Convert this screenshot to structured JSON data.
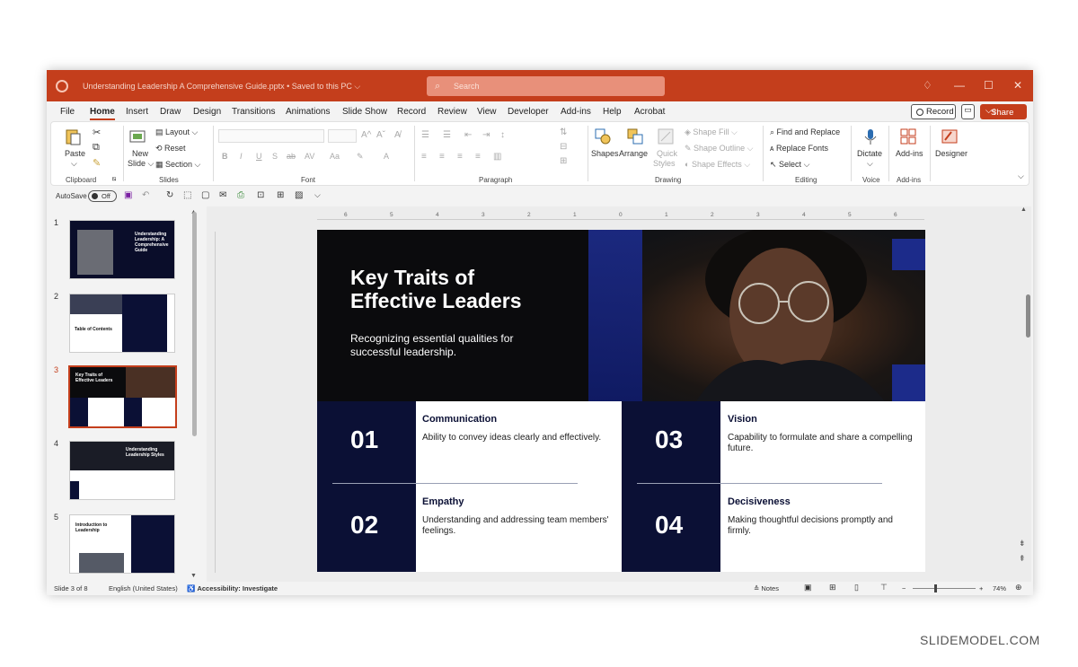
{
  "window": {
    "doc_title": "Understanding Leadership A Comprehensive Guide.pptx  •  Saved to this PC ⌵",
    "search_placeholder": "Search"
  },
  "menu": {
    "tabs": [
      "File",
      "Home",
      "Insert",
      "Draw",
      "Design",
      "Transitions",
      "Animations",
      "Slide Show",
      "Record",
      "Review",
      "View",
      "Developer",
      "Add-ins",
      "Help",
      "Acrobat"
    ],
    "active": "Home",
    "record_label": "Record",
    "share_label": "Share"
  },
  "ribbon": {
    "clipboard": {
      "paste": "Paste",
      "label": "Clipboard"
    },
    "slides": {
      "new_slide": "New",
      "new_slide2": "Slide",
      "layout": "Layout",
      "reset": "Reset",
      "section": "Section",
      "label": "Slides"
    },
    "font": {
      "label": "Font"
    },
    "paragraph": {
      "label": "Paragraph"
    },
    "drawing": {
      "shapes": "Shapes",
      "arrange": "Arrange",
      "quick": "Quick",
      "styles": "Styles",
      "shape_fill": "Shape Fill",
      "shape_outline": "Shape Outline",
      "shape_effects": "Shape Effects",
      "label": "Drawing"
    },
    "editing": {
      "find": "Find and Replace",
      "replace_fonts": "Replace Fonts",
      "select": "Select",
      "label": "Editing"
    },
    "voice": {
      "dictate": "Dictate",
      "label": "Voice"
    },
    "addins": {
      "addins": "Add-ins",
      "label": "Add-ins"
    },
    "designer": {
      "label": "Designer"
    }
  },
  "qat": {
    "autosave": "AutoSave",
    "toggle": "Off"
  },
  "thumbnails": [
    {
      "num": "1",
      "title": "Understanding Leadership: A Comprehensive Guide"
    },
    {
      "num": "2",
      "title": "Table of Contents"
    },
    {
      "num": "3",
      "title": "Key Traits of Effective Leaders"
    },
    {
      "num": "4",
      "title": "Understanding Leadership Styles"
    },
    {
      "num": "5",
      "title": "Introduction to Leadership"
    }
  ],
  "slide": {
    "title_line1": "Key Traits of",
    "title_line2": "Effective Leaders",
    "subtitle": "Recognizing essential qualities for successful leadership.",
    "traits": [
      {
        "num": "01",
        "title": "Communication",
        "desc": "Ability to convey ideas clearly and effectively."
      },
      {
        "num": "02",
        "title": "Empathy",
        "desc": "Understanding and addressing team members' feelings."
      },
      {
        "num": "03",
        "title": "Vision",
        "desc": "Capability to formulate and share a compelling future."
      },
      {
        "num": "04",
        "title": "Decisiveness",
        "desc": "Making thoughtful decisions promptly and firmly."
      }
    ]
  },
  "ruler": {
    "marks": [
      "6",
      "5",
      "4",
      "3",
      "2",
      "1",
      "0",
      "1",
      "2",
      "3",
      "4",
      "5",
      "6"
    ]
  },
  "status": {
    "slide_of": "Slide 3 of 8",
    "language": "English (United States)",
    "accessibility": "Accessibility: Investigate",
    "notes": "Notes",
    "zoom": "74%"
  },
  "watermark": "SLIDEMODEL.COM",
  "colors": {
    "accent": "#c43e1c",
    "navy": "#0b1035"
  }
}
